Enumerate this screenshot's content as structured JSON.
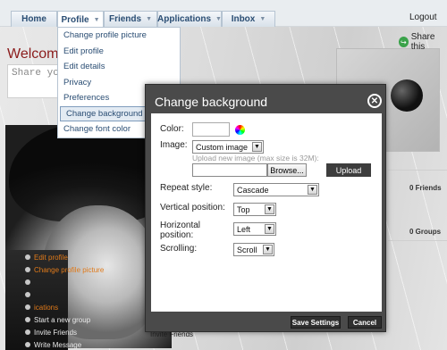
{
  "nav": {
    "tabs": [
      {
        "label": "Home",
        "has_caret": false
      },
      {
        "label": "Profile",
        "has_caret": true
      },
      {
        "label": "Friends",
        "has_caret": true
      },
      {
        "label": "Applications",
        "has_caret": true
      },
      {
        "label": "Inbox",
        "has_caret": true
      }
    ],
    "caret_glyph": "▼",
    "logout": "Logout"
  },
  "profile_menu": {
    "items": [
      "Change profile picture",
      "Edit profile",
      "Edit details",
      "Privacy",
      "Preferences",
      "Change background",
      "Change font color"
    ],
    "active_item": "Change background"
  },
  "page": {
    "welcome": "Welcome",
    "share_placeholder": "Share your",
    "share_this": "Share this",
    "friends_count": "0 Friends",
    "groups_count": "0 Groups",
    "invite_friends_under": "Invite Friends"
  },
  "side_links": [
    {
      "label": "Edit profile",
      "style": "orange"
    },
    {
      "label": "Change profile picture",
      "style": "orange"
    },
    {
      "label": "",
      "style": "white"
    },
    {
      "label": "",
      "style": "white"
    },
    {
      "label": "ications",
      "style": "orange"
    },
    {
      "label": "Start a new group",
      "style": "white"
    },
    {
      "label": "Invite Friends",
      "style": "white"
    },
    {
      "label": "Write Message",
      "style": "white"
    }
  ],
  "dialog": {
    "title": "Change background",
    "close_glyph": "✕",
    "color_label": "Color:",
    "image_label": "Image:",
    "image_value": "Custom image",
    "upload_note": "Upload new image (max size is 32M):",
    "browse_label": "Browse...",
    "upload_label": "Upload",
    "repeat_label": "Repeat style:",
    "repeat_value": "Cascade",
    "vertical_label": "Vertical position:",
    "vertical_value": "Top",
    "horizontal_label": "Horizontal position:",
    "horizontal_value": "Left",
    "scrolling_label": "Scrolling:",
    "scrolling_value": "Scroll",
    "save_label": "Save Settings",
    "cancel_label": "Cancel",
    "arrow_glyph": "▼"
  }
}
